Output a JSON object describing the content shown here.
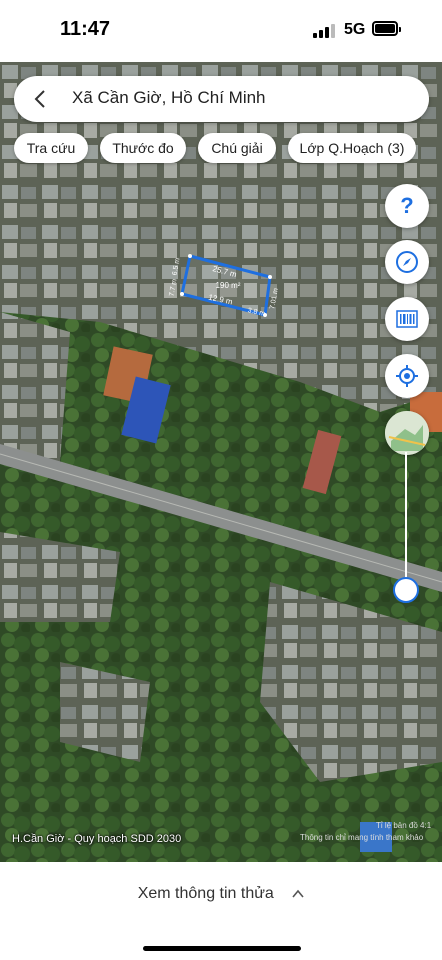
{
  "status_bar": {
    "time": "11:47",
    "network": "5G"
  },
  "search": {
    "title": "Xã Cần Giờ, Hồ Chí Minh"
  },
  "chips": [
    {
      "label": "Tra cứu"
    },
    {
      "label": "Thước đo"
    },
    {
      "label": "Chú giải"
    },
    {
      "label": "Lớp Q.Hoạch (3)"
    }
  ],
  "parcel": {
    "area": "190 m²",
    "top_edge": "25.7 m",
    "left_edge_top": "6.5 m",
    "left_edge_bottom": "7.7 m",
    "bottom_edge": "12.9 m",
    "bottom_right_edge": "3.8 m",
    "right_edge": "7.01 m"
  },
  "controls": {
    "help": "?",
    "icons": [
      "help-icon",
      "compass-icon",
      "barcode-icon",
      "locate-icon",
      "layer-thumbnail-icon"
    ]
  },
  "map": {
    "caption": "H.Cần Giờ - Quy hoạch SDD 2030",
    "scale": "Tỉ lệ bản đồ 4:1",
    "note": "Thông tin chỉ mang tính tham khảo"
  },
  "bottom": {
    "more_label": "Xem thông tin thửa"
  },
  "colors": {
    "accent": "#1e6fe0"
  }
}
